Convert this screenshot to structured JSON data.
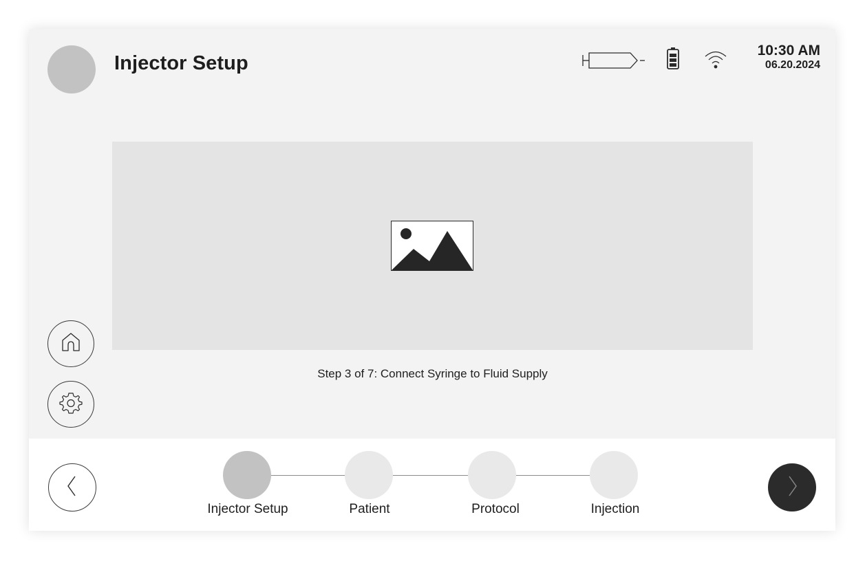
{
  "header": {
    "title": "Injector Setup",
    "time": "10:30 AM",
    "date": "06.20.2024"
  },
  "status_icons": [
    "syringe-icon",
    "battery-icon",
    "wifi-icon"
  ],
  "main": {
    "media_icon": "image-placeholder-icon",
    "step_caption": "Step 3 of 7: Connect Syringe to Fluid Supply"
  },
  "side_nav": {
    "items": [
      "home-icon",
      "gear-icon"
    ]
  },
  "stepper": {
    "steps": [
      {
        "label": "Injector Setup",
        "active": true
      },
      {
        "label": "Patient",
        "active": false
      },
      {
        "label": "Protocol",
        "active": false
      },
      {
        "label": "Injection",
        "active": false
      }
    ]
  },
  "footer": {
    "back_icon": "chevron-left-icon",
    "next_icon": "chevron-right-icon"
  },
  "colors": {
    "background": "#f3f3f3",
    "panel": "#e4e4e4",
    "accent_dark": "#2b2b2b",
    "step_active": "#c2c2c2",
    "step_inactive": "#e9e9e9"
  }
}
